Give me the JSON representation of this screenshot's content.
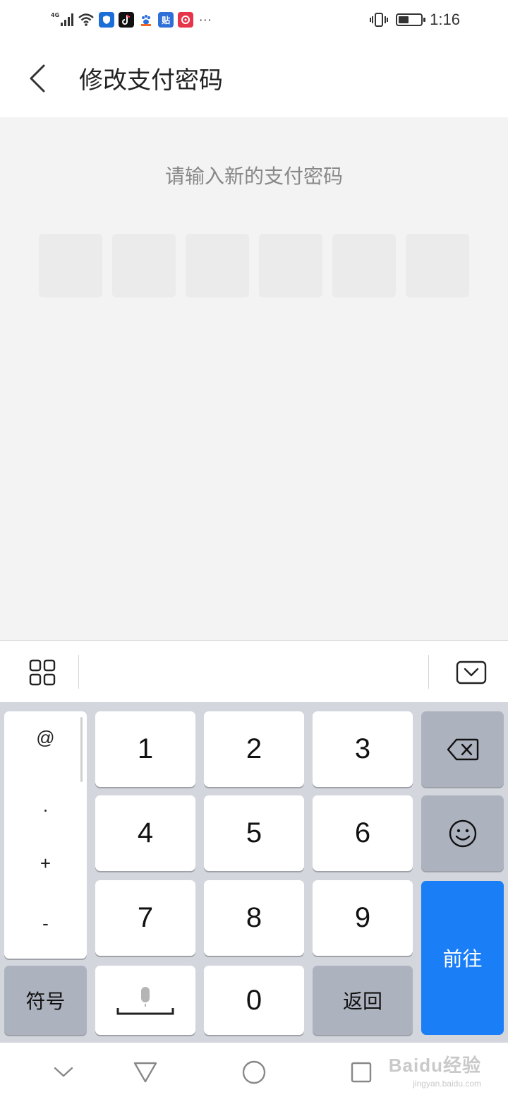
{
  "status_bar": {
    "signal_label": "4G",
    "time": "1:16",
    "battery_level": 0.45,
    "icons": [
      "signal-icon",
      "wifi-icon",
      "shield-app-icon",
      "tiktok-app-icon",
      "baidu-app-icon",
      "tieba-app-icon",
      "video-app-icon",
      "more-dots-icon",
      "vibrate-icon",
      "battery-icon"
    ],
    "more": "···",
    "app_glyphs": {
      "tieba": "贴"
    }
  },
  "header": {
    "title": "修改支付密码",
    "back_icon": "chevron-left-icon"
  },
  "content": {
    "prompt": "请输入新的支付密码",
    "pin_length": 6
  },
  "keyboard_toolbar": {
    "left_icon": "grid-apps-icon",
    "right_icon": "keyboard-hide-icon"
  },
  "keyboard": {
    "symbols": [
      "@",
      ".",
      "+",
      "-"
    ],
    "digits": [
      "1",
      "2",
      "3",
      "4",
      "5",
      "6",
      "7",
      "8",
      "9",
      "0"
    ],
    "symbol_key": "符号",
    "return_key": "返回",
    "go_key": "前往",
    "backspace_icon": "backspace-icon",
    "emoji_icon": "emoji-icon",
    "space_icon": "microphone-space-icon",
    "colors": {
      "go": "#1a7ef7",
      "function_key": "#adb3be",
      "background": "#d3d6dd"
    }
  },
  "nav_bar": {
    "icons": [
      "collapse-chevron-icon",
      "back-triangle-icon",
      "home-circle-icon",
      "recents-square-icon"
    ]
  },
  "watermark": {
    "main": "Baidu经验",
    "sub": "jingyan.baidu.com"
  }
}
